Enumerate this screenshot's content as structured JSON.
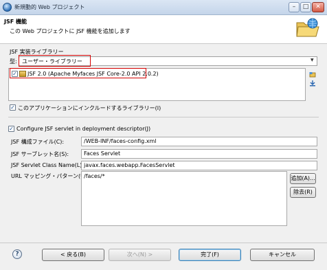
{
  "window": {
    "title": "新規動的 Web プロジェクト",
    "minimize": "–",
    "maximize": "□",
    "close": "✕"
  },
  "header": {
    "title": "JSF 機能",
    "description": "この Web プロジェクトに JSF 機能を追加します"
  },
  "library": {
    "section_label": "JSF 実装ライブラリー",
    "type_label": "型:",
    "type_value": "ユーザー・ライブラリー",
    "items": [
      {
        "label": "JSF 2.0 (Apache Myfaces JSF Core-2.0 API 2.0.2)",
        "checked": true
      }
    ],
    "include_label": "このアプリケーションにインクルードするライブラリー(I)",
    "include_checked": true
  },
  "servlet": {
    "configure_label": "Configure JSF servlet in deployment descriptor(J)",
    "configure_checked": true,
    "config_file_label": "JSF 構成ファイル(C):",
    "config_file_value": "/WEB-INF/faces-config.xml",
    "servlet_name_label": "JSF サーブレット名(S):",
    "servlet_name_value": "Faces Servlet",
    "servlet_class_label": "JSF Servlet Class Name(L):",
    "servlet_class_value": "javax.faces.webapp.FacesServlet",
    "url_mapping_label": "URL マッピング・パターン(U):",
    "url_mappings": [
      "/faces/*"
    ],
    "add_button": "追加(A)...",
    "remove_button": "除去(R)"
  },
  "footer": {
    "help": "?",
    "back": "< 戻る(B)",
    "next": "次へ(N) >",
    "finish": "完了(F)",
    "cancel": "キャンセル"
  }
}
